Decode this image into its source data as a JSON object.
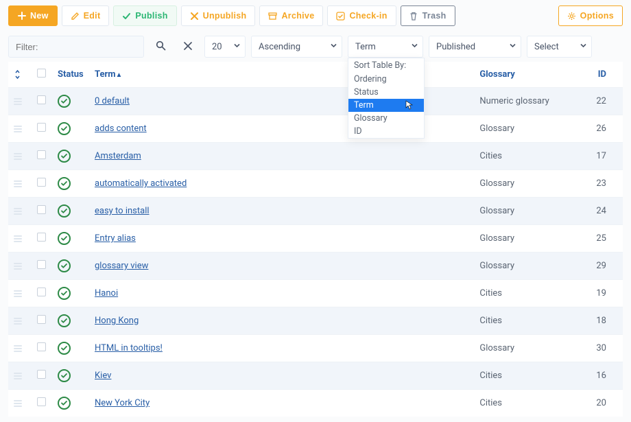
{
  "toolbar": {
    "new": "New",
    "edit": "Edit",
    "publish": "Publish",
    "unpublish": "Unpublish",
    "archive": "Archive",
    "checkin": "Check-in",
    "trash": "Trash",
    "options": "Options"
  },
  "filter": {
    "placeholder": "Filter:",
    "page_size": "20",
    "direction": "Ascending",
    "sort_column": "Term",
    "state": "Published",
    "category": "Select",
    "dropdown": {
      "header": "Sort Table By:",
      "options": [
        "Ordering",
        "Status",
        "Term",
        "Glossary",
        "ID"
      ],
      "active": "Term"
    }
  },
  "columns": {
    "status": "Status",
    "term": "Term",
    "glossary": "Glossary",
    "id": "ID"
  },
  "rows": [
    {
      "term": "0 default",
      "glossary": "Numeric glossary",
      "id": 22
    },
    {
      "term": "adds content",
      "glossary": "Glossary",
      "id": 26
    },
    {
      "term": "Amsterdam",
      "glossary": "Cities",
      "id": 17
    },
    {
      "term": "automatically activated",
      "glossary": "Glossary",
      "id": 23
    },
    {
      "term": "easy to install",
      "glossary": "Glossary",
      "id": 24
    },
    {
      "term": "Entry alias",
      "glossary": "Glossary",
      "id": 25
    },
    {
      "term": "glossary view",
      "glossary": "Glossary",
      "id": 29
    },
    {
      "term": "Hanoi",
      "glossary": "Cities",
      "id": 19
    },
    {
      "term": "Hong Kong",
      "glossary": "Cities",
      "id": 18
    },
    {
      "term": "HTML in tooltips!",
      "glossary": "Glossary",
      "id": 30
    },
    {
      "term": "Kiev",
      "glossary": "Cities",
      "id": 16
    },
    {
      "term": "New York City",
      "glossary": "Cities",
      "id": 20
    }
  ]
}
